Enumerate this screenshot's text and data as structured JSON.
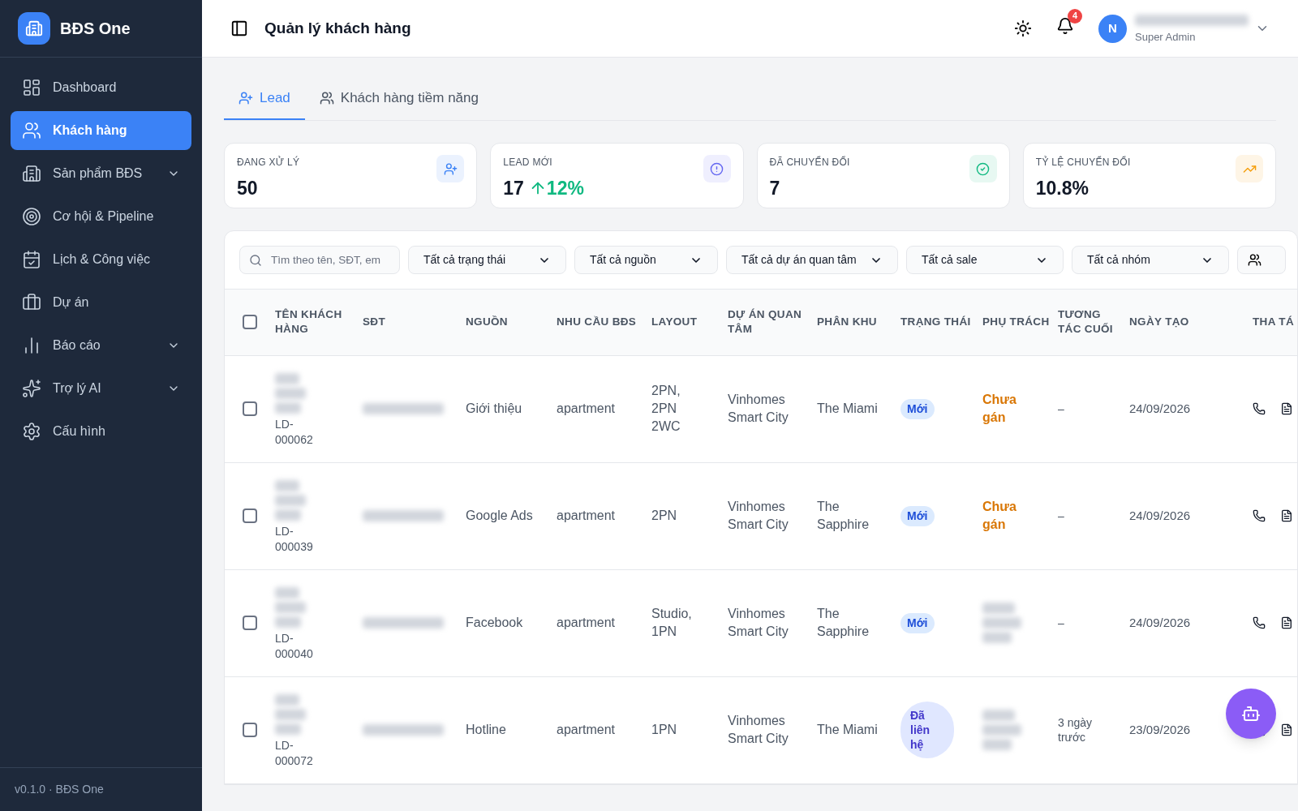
{
  "brand": {
    "name": "BĐS One"
  },
  "sidebar": {
    "items": [
      {
        "label": "Dashboard",
        "selected": false,
        "has_submenu": false
      },
      {
        "label": "Khách hàng",
        "selected": true,
        "has_submenu": false
      },
      {
        "label": "Sản phẩm BĐS",
        "selected": false,
        "has_submenu": true
      },
      {
        "label": "Cơ hội & Pipeline",
        "selected": false,
        "has_submenu": false
      },
      {
        "label": "Lịch & Công việc",
        "selected": false,
        "has_submenu": false
      },
      {
        "label": "Dự án",
        "selected": false,
        "has_submenu": false
      },
      {
        "label": "Báo cáo",
        "selected": false,
        "has_submenu": true
      },
      {
        "label": "Trợ lý AI",
        "selected": false,
        "has_submenu": true
      },
      {
        "label": "Cấu hình",
        "selected": false,
        "has_submenu": false
      }
    ],
    "footer": "v0.1.0 · BĐS One"
  },
  "header": {
    "title": "Quản lý khách hàng",
    "notification_count": "4",
    "user": {
      "initial": "N",
      "role": "Super Admin"
    }
  },
  "tabs": [
    {
      "label": "Lead",
      "selected": true
    },
    {
      "label": "Khách hàng tiềm năng",
      "selected": false
    }
  ],
  "stats": [
    {
      "label": "ĐANG XỬ LÝ",
      "value": "50",
      "color": "#3b82f6"
    },
    {
      "label": "LEAD MỚI",
      "value": "17",
      "change": "12%",
      "color": "#6366f1"
    },
    {
      "label": "ĐÃ CHUYỂN ĐỔI",
      "value": "7",
      "color": "#10b981"
    },
    {
      "label": "TỶ LỆ CHUYỂN ĐỔI",
      "value": "10.8%",
      "color": "#f59e0b"
    }
  ],
  "filters": {
    "search": {
      "placeholder": "Tìm theo tên, SĐT, em"
    },
    "selects": [
      "Tất cả trạng thái",
      "Tất cả nguồn",
      "Tất cả dự án quan tâm",
      "Tất cả sale",
      "Tất cả nhóm"
    ]
  },
  "table": {
    "select_all": false,
    "columns": [
      "TÊN KHÁCH HÀNG",
      "SĐT",
      "NGUỒN",
      "NHU CẦU BĐS",
      "LAYOUT",
      "DỰ ÁN QUAN TÂM",
      "PHÂN KHU",
      "TRẠNG THÁI",
      "PHỤ TRÁCH",
      "TƯƠNG TÁC CUỐI",
      "NGÀY TẠO",
      "THA TÁ"
    ],
    "rows": [
      {
        "selected": false,
        "code": "LD-000062",
        "source": "Giới thiệu",
        "need": "apartment",
        "layout": "2PN, 2PN 2WC",
        "project": "Vinhomes Smart City",
        "zone": "The Miami",
        "status": {
          "kind": "new",
          "label": "Mới"
        },
        "owner": {
          "kind": "unassigned",
          "label": "Chưa gán"
        },
        "last_contact": "–",
        "created": "24/09/2026"
      },
      {
        "selected": false,
        "code": "LD-000039",
        "source": "Google Ads",
        "need": "apartment",
        "layout": "2PN",
        "project": "Vinhomes Smart City",
        "zone": "The Sapphire",
        "status": {
          "kind": "new",
          "label": "Mới"
        },
        "owner": {
          "kind": "unassigned",
          "label": "Chưa gán"
        },
        "last_contact": "–",
        "created": "24/09/2026"
      },
      {
        "selected": false,
        "code": "LD-000040",
        "source": "Facebook",
        "need": "apartment",
        "layout": "Studio, 1PN",
        "project": "Vinhomes Smart City",
        "zone": "The Sapphire",
        "status": {
          "kind": "new",
          "label": "Mới"
        },
        "owner": {
          "kind": "hidden"
        },
        "last_contact": "–",
        "created": "24/09/2026"
      },
      {
        "selected": false,
        "code": "LD-000072",
        "source": "Hotline",
        "need": "apartment",
        "layout": "1PN",
        "project": "Vinhomes Smart City",
        "zone": "The Miami",
        "status": {
          "kind": "contacted",
          "label": "Đã liên hệ"
        },
        "owner": {
          "kind": "hidden"
        },
        "last_contact": "3 ngày trước",
        "created": "23/09/2026"
      }
    ]
  }
}
